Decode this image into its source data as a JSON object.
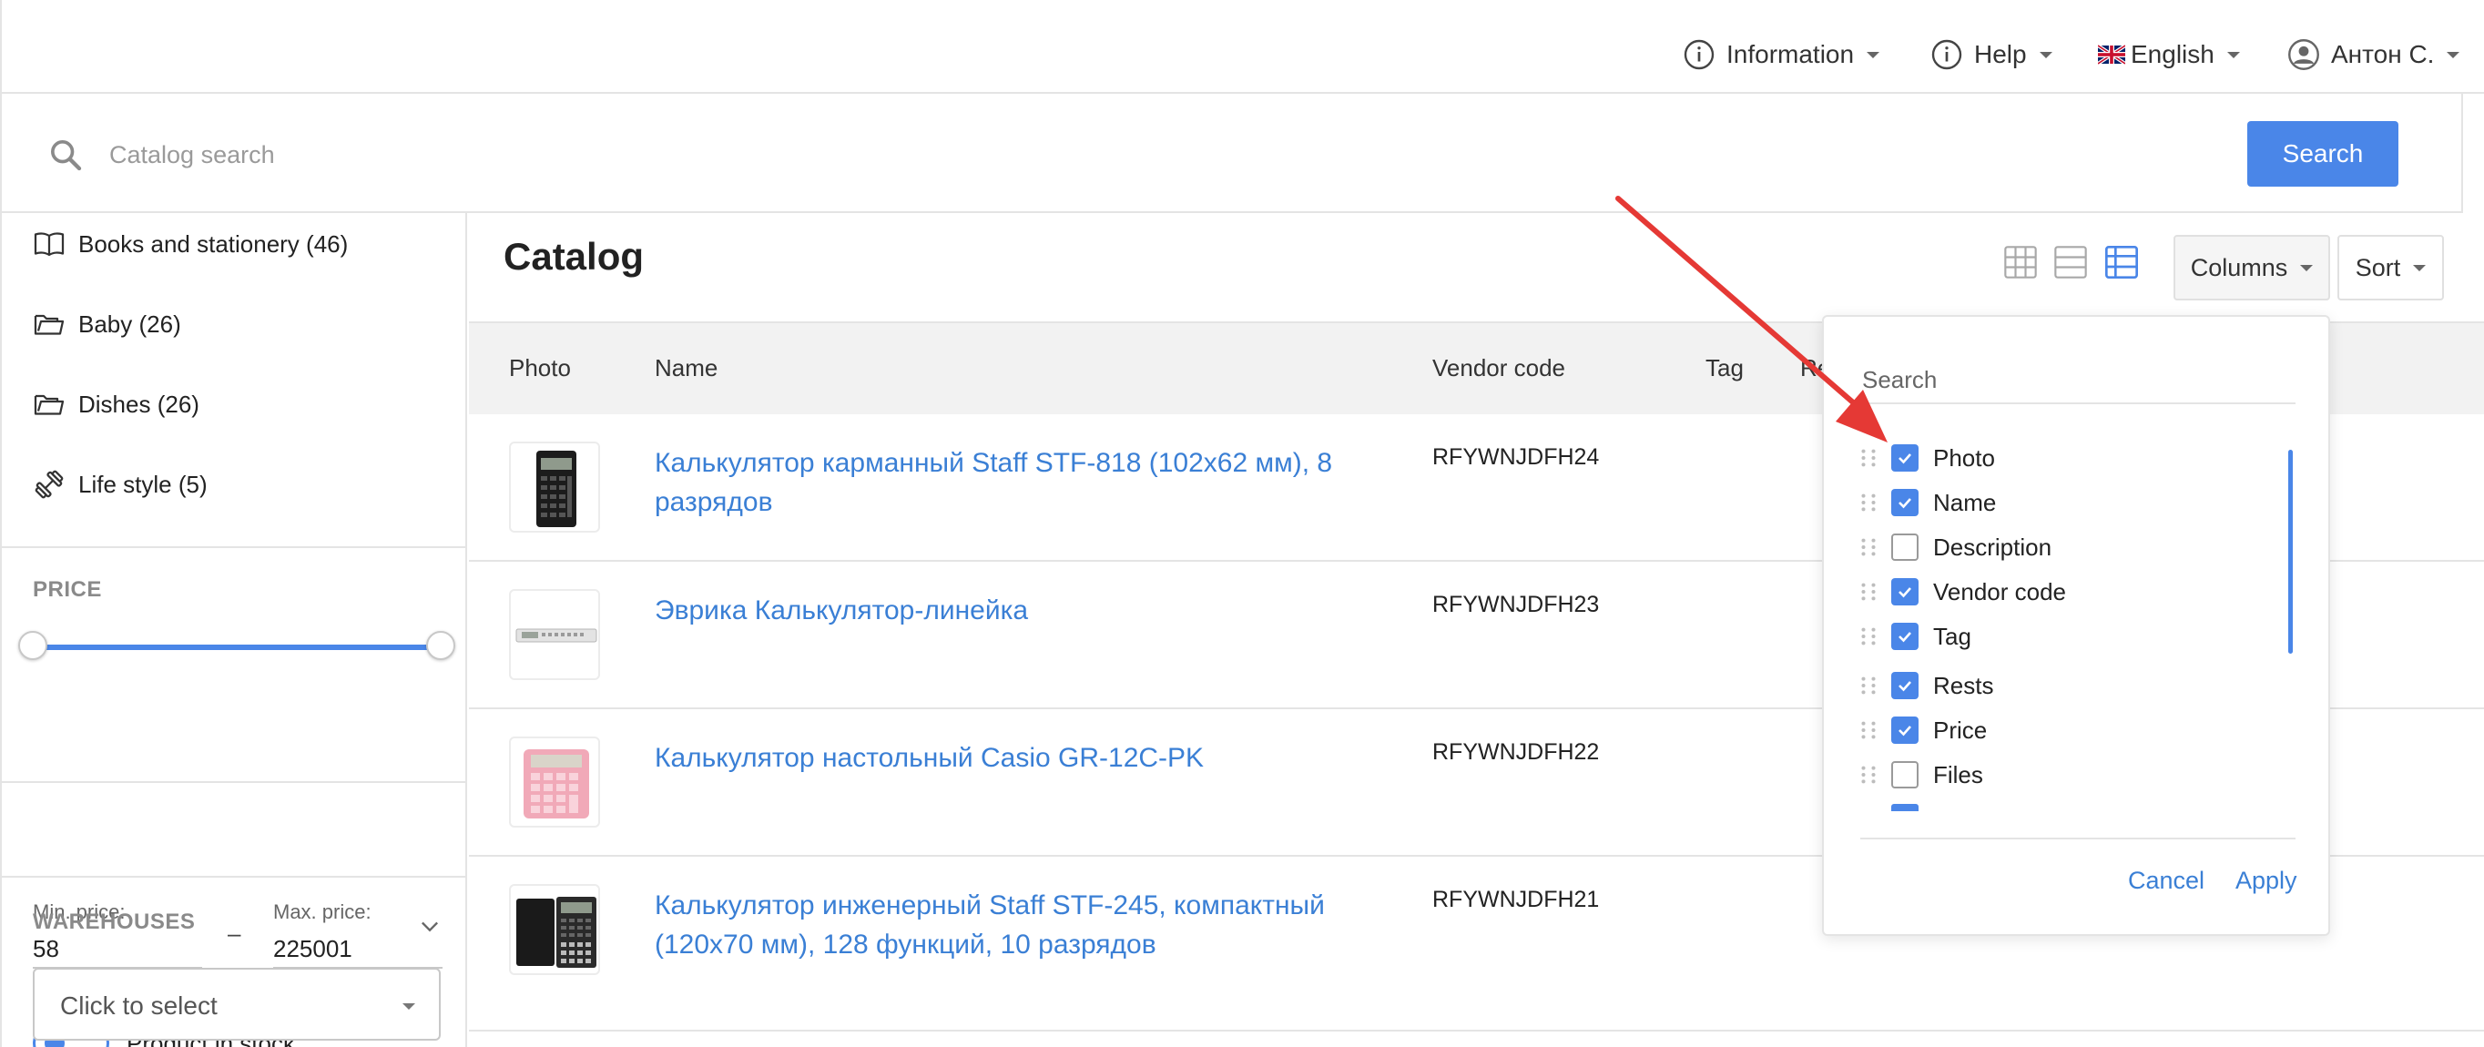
{
  "topnav": {
    "information": "Information",
    "help": "Help",
    "language": "English",
    "user": "Антон С."
  },
  "search": {
    "placeholder": "Catalog search",
    "button": "Search"
  },
  "sidebar": {
    "categories": [
      {
        "label": "Books and stationery (46)",
        "icon": "book-icon"
      },
      {
        "label": "Baby (26)",
        "icon": "folder-icon"
      },
      {
        "label": "Dishes (26)",
        "icon": "folder-icon"
      },
      {
        "label": "Life style (5)",
        "icon": "dumbbell-icon"
      }
    ],
    "price": {
      "title": "PRICE",
      "min_label": "Min. price:",
      "max_label": "Max. price:",
      "min_value": "58",
      "max_value": "225001",
      "dash": "–"
    },
    "in_stock_label": "Product in stock",
    "in_stock": true,
    "warehouses": {
      "title": "WAREHOUSES",
      "placeholder": "Click to select"
    }
  },
  "main": {
    "title": "Catalog",
    "columns_button": "Columns",
    "sort_button": "Sort",
    "active_view": "table",
    "table": {
      "headers": {
        "photo": "Photo",
        "name": "Name",
        "vendor": "Vendor code",
        "tag": "Tag",
        "rests": "Re"
      },
      "rows": [
        {
          "name": "Калькулятор карманный Staff STF-818 (102х62 мм), 8 разрядов",
          "vendor_code": "RFYWNJDFH24"
        },
        {
          "name": "Эврика Калькулятор-линейка",
          "vendor_code": "RFYWNJDFH23"
        },
        {
          "name": "Калькулятор настольный Casio GR-12C-PK",
          "vendor_code": "RFYWNJDFH22"
        },
        {
          "name": "Калькулятор инженерный Staff STF-245, компактный (120х70 мм), 128 функций, 10 разрядов",
          "vendor_code": "RFYWNJDFH21"
        }
      ]
    }
  },
  "columns_dropdown": {
    "search_placeholder": "Search",
    "items": [
      {
        "label": "Photo",
        "checked": true
      },
      {
        "label": "Name",
        "checked": true
      },
      {
        "label": "Description",
        "checked": false
      },
      {
        "label": "Vendor code",
        "checked": true
      },
      {
        "label": "Tag",
        "checked": true
      },
      {
        "label": "Rests",
        "checked": true
      },
      {
        "label": "Price",
        "checked": true
      },
      {
        "label": "Files",
        "checked": false
      }
    ],
    "cancel": "Cancel",
    "apply": "Apply"
  },
  "colors": {
    "accent": "#4a86e8",
    "link": "#3a7fd5",
    "annotation_arrow": "#e53935"
  }
}
